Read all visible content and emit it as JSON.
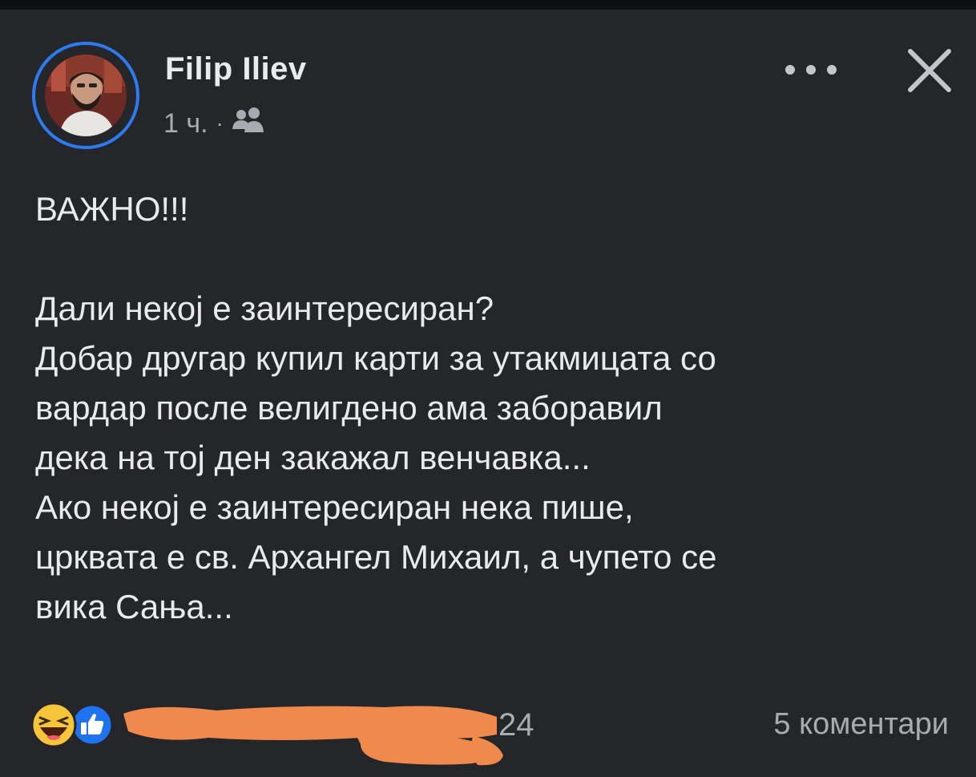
{
  "post": {
    "author": "Filip Iliev",
    "time": "1 ч.",
    "separator": "·",
    "audience_icon": "group-icon",
    "body": {
      "heading": "ВАЖНО!!!",
      "lines": [
        "Дали некој е заинтересиран?",
        "Добар другар купил карти за утакмицата со",
        "вардар после велигдено ама заборавил",
        "дека на тој ден закажал венчавка...",
        "Ако некој е заинтересиран нека пише,",
        "црквата е св. Архангел Михаил, а чупето се",
        "вика Сања..."
      ]
    },
    "reactions": {
      "icons": [
        "haha-icon",
        "like-icon"
      ],
      "count_fragment": "24"
    },
    "comments_label": "5 коментари"
  },
  "colors": {
    "background": "#252629",
    "avatar_ring": "#2d7bf2",
    "text_primary": "#e9eaee",
    "text_secondary": "#a9abb0",
    "redaction": "#ef8a4c"
  }
}
